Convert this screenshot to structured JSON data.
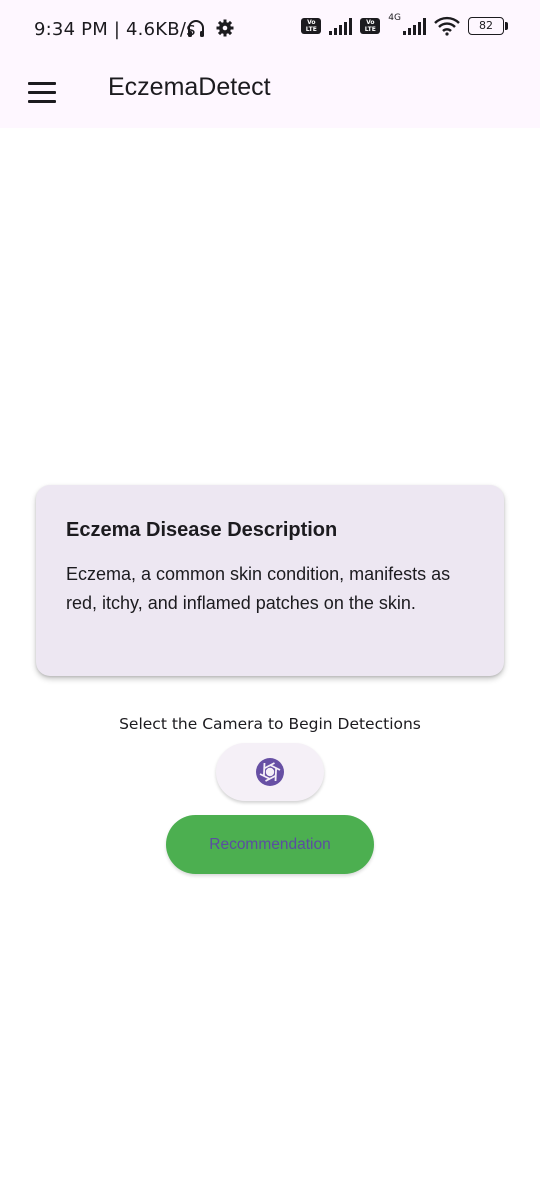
{
  "status_bar": {
    "time": "9:34 PM | 4.6KB/s",
    "volte_badge_1": "Vo LTE",
    "volte_badge_2": "Vo LTE",
    "network_type": "4G",
    "battery": "82",
    "icons": [
      "headphones-icon",
      "settings-icon",
      "signal-icon",
      "wifi-icon",
      "battery-icon"
    ]
  },
  "app_bar": {
    "title": "EczemaDetect",
    "menu_icon": "hamburger-menu-icon"
  },
  "card": {
    "title": "Eczema Disease Description",
    "body": "Eczema, a common skin condition, manifests as red, itchy, and inflamed patches on the skin."
  },
  "main": {
    "prompt": "Select the Camera to Begin Detections",
    "camera_icon": "camera-shutter-icon",
    "recommendation_label": "Recommendation"
  },
  "colors": {
    "app_bar_bg": "#fef7ff",
    "card_bg": "#ede7f2",
    "accent": "#6750a4",
    "recommendation_bg": "#4caf50"
  }
}
